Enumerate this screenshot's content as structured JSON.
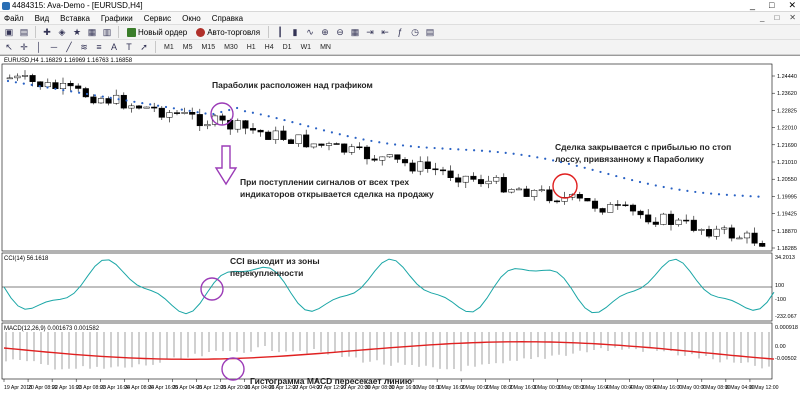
{
  "window": {
    "title": "4484315: Ava-Demo - [EURUSD,H4]",
    "controls": [
      "_",
      "□",
      "✕"
    ]
  },
  "menu": {
    "items": [
      "Файл",
      "Вид",
      "Вставка",
      "Графики",
      "Сервис",
      "Окно",
      "Справка"
    ],
    "mdi_controls": [
      "_",
      "□",
      "✕"
    ]
  },
  "toolbar": {
    "new_order": "Новый ордер",
    "auto_trading": "Авто-торговля",
    "timeframes": [
      "M1",
      "M5",
      "M15",
      "M30",
      "H1",
      "H4",
      "D1",
      "W1",
      "MN"
    ]
  },
  "chart": {
    "header": "EURUSD,H4  1.16829 1.16969 1.16763 1.16858",
    "price_ticks": [
      "1.24440",
      "1.23620",
      "1.22825",
      "1.22010",
      "1.21690",
      "1.21010",
      "1.20550",
      "1.19995",
      "1.19425",
      "1.18870",
      "1.18285"
    ],
    "cci_label": "CCI(14) 56.1618",
    "cci_ticks": [
      "34.2013",
      "100",
      "-100",
      "-232.067"
    ],
    "macd_label": "MACD(12,26,9) 0.001673 0.001582",
    "macd_ticks": [
      "0.000918",
      "0.00",
      "-0.00502"
    ],
    "time_ticks": [
      "19 Apr 2018",
      "20 Apr 08:00",
      "22 Apr 16:00",
      "23 Apr 08:00",
      "23 Apr 16:00",
      "24 Apr 08:00",
      "24 Apr 16:00",
      "25 Apr 04:00",
      "25 Apr 12:00",
      "25 Apr 20:00",
      "26 Apr 04:00",
      "26 Apr 12:00",
      "27 Apr 04:00",
      "27 Apr 12:00",
      "27 Apr 20:00",
      "30 Apr 08:00",
      "30 Apr 16:00",
      "1 May 08:00",
      "1 May 16:00",
      "2 May 00:00",
      "2 May 08:00",
      "2 May 16:00",
      "3 May 00:00",
      "3 May 08:00",
      "3 May 16:00",
      "4 May 00:00",
      "4 May 08:00",
      "4 May 16:00",
      "7 May 00:00",
      "7 May 08:00",
      "8 May 04:00",
      "8 May 12:00"
    ]
  },
  "annotations": {
    "parabolic": "Параболик расположен над графиком",
    "signal_line1": "При поступлении сигналов от всех трех",
    "signal_line2": "индикаторов открывается сделка на продажу",
    "close_line1": "Сделка закрывается с прибылью по стоп",
    "close_line2": "лоссу, привязанному к  Параболику",
    "cci_line1": "CCI выходит из зоны",
    "cci_line2": "перекупленности",
    "macd": "Гистограмма MACD пересекает линию"
  },
  "colors": {
    "candle_outline": "#000000",
    "parabolic_dots": "#2a62c4",
    "cci_line": "#1aa6a6",
    "macd_signal": "#e02020",
    "macd_hist": "#8a8a8a",
    "highlight_circle": "#9b3bb7",
    "close_circle": "#e02020",
    "arrow": "#9b3bb7"
  }
}
